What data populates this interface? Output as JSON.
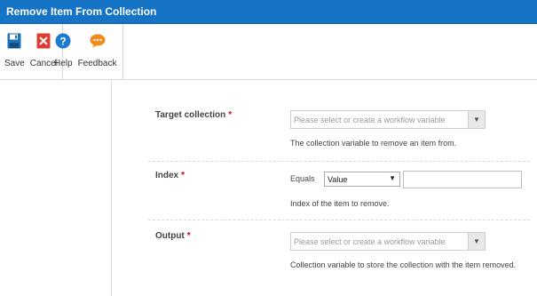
{
  "window": {
    "title": "Remove Item From Collection"
  },
  "toolbar": {
    "save_label": "Save",
    "cancel_label": "Cancel",
    "help_label": "Help",
    "feedback_label": "Feedback",
    "icons": {
      "save": "floppy-disk-icon",
      "cancel": "close-icon",
      "help": "question-mark-icon",
      "feedback": "speech-bubble-icon"
    }
  },
  "form": {
    "target_collection": {
      "label": "Target collection",
      "required_mark": "*",
      "placeholder": "Please select or create a workflow variable",
      "help": "The collection variable to remove an item from."
    },
    "index": {
      "label": "Index",
      "required_mark": "*",
      "operator_label": "Equals",
      "value_type": "Value",
      "value": "",
      "help": "Index of the item to remove."
    },
    "output": {
      "label": "Output",
      "required_mark": "*",
      "placeholder": "Please select or create a workflow variable",
      "help": "Collection variable to store the collection with the item removed."
    }
  },
  "colors": {
    "titlebar": "#1574c6",
    "required": "#d0021b",
    "save_icon": "#1f6fb5",
    "cancel_icon": "#e03c31",
    "help_icon": "#1f7ad1",
    "feedback_icon": "#f28a1a"
  }
}
